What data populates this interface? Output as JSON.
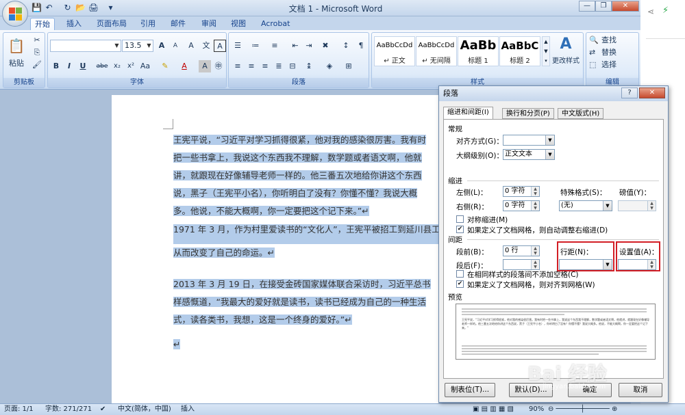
{
  "window": {
    "title": "文档 1 - Microsoft Word"
  },
  "qat": {
    "save": "💾",
    "undo": "↶",
    "redo": "↻",
    "open": "📂",
    "print": "🖨",
    "more": "▾"
  },
  "tabs": [
    "开始",
    "插入",
    "页面布局",
    "引用",
    "邮件",
    "审阅",
    "视图",
    "Acrobat"
  ],
  "ribbon": {
    "clipboard": {
      "label": "剪贴板",
      "paste": "粘贴"
    },
    "font": {
      "label": "字体",
      "name": "",
      "size": "13.5",
      "bold": "B",
      "italic": "I",
      "underline": "U",
      "strike": "abe",
      "sub": "x₂",
      "sup": "x²",
      "case": "Aa",
      "grow": "A",
      "shrink": "A",
      "clear": "A"
    },
    "paragraph": {
      "label": "段落"
    },
    "styles": {
      "label": "样式",
      "items": [
        {
          "sample": "AaBbCcDd",
          "name": "↵ 正文"
        },
        {
          "sample": "AaBbCcDd",
          "name": "↵ 无间隔"
        },
        {
          "sample": "AaBb",
          "name": "标题 1"
        },
        {
          "sample": "AaBbC",
          "name": "标题 2"
        }
      ],
      "change": "更改样式"
    },
    "editing": {
      "label": "编辑",
      "find": "查找",
      "replace": "替换",
      "select": "选择"
    }
  },
  "document": {
    "lines": [
      "王宪平说，“习近平对学习抓得很紧，他对我的感染很厉害。我有时",
      "把一些书拿上，我说这个东西我不理解，数学题或者语文啊，他就",
      "讲，就跟现在好像辅导老师一样的。他三番五次地给你讲这个东西",
      "说，黑子（王宪平小名），你听明白了没有？你懂不懂？我说大概",
      "多。他说，不能大概啊，你一定要把这个记下来。”↵",
      "1971 年 3 月，作为村里爱读书的“文化人”，王宪平被招工到延川县工",
      "从而改变了自己的命运。↵",
      "2013 年 3 月 19 日，在接受金砖国家媒体联合采访时，习近平总书",
      "样感慨道，“我最大的爱好就是读书，读书已经成为自己的一种生活",
      "式，读各类书，我想，这是一个终身的爱好。”↵",
      "↵"
    ]
  },
  "status": {
    "page": "页面: 1/1",
    "words": "字数: 271/271",
    "lang": "中文(简体，中国)",
    "mode": "插入",
    "zoom": "90%"
  },
  "dialog": {
    "title": "段落",
    "help": "?",
    "close": "✕",
    "tabs": [
      "缩进和间距(I)",
      "换行和分页(P)",
      "中文版式(H)"
    ],
    "general": {
      "label": "常规",
      "align_label": "对齐方式(G)：",
      "align_value": "",
      "outline_label": "大纲级别(O)：",
      "outline_value": "正文文本"
    },
    "indent": {
      "label": "缩进",
      "left_label": "左侧(L)：",
      "left_value": "0 字符",
      "right_label": "右侧(R)：",
      "right_value": "0 字符",
      "special_label": "特殊格式(S)：",
      "special_value": "(无)",
      "by_label": "磅值(Y)：",
      "by_value": "",
      "mirror": "对称缩进(M)",
      "auto_right": "如果定义了文档网格，则自动调整右缩进(D)"
    },
    "spacing": {
      "label": "间距",
      "before_label": "段前(B)：",
      "before_value": "0 行",
      "after_label": "段后(F)：",
      "after_value": "",
      "line_label": "行距(N)：",
      "line_value": "",
      "at_label": "设置值(A)：",
      "at_value": "",
      "no_space": "在相同样式的段落间不添加空格(C)",
      "snap_grid": "如果定义了文档网格，则对齐到网格(W)"
    },
    "preview": {
      "label": "预览",
      "sample_text": "王宪平说，“习近平对学习抓得很紧，他对我的感染很厉害。我有时把一些书拿上，我说这个东西我不理解，数学题或者语文啊，他就讲，就跟现在好像辅导老师一样的。他三番五次地给你讲这个东西说，黑子（王宪平小名），你听明白了没有？你懂不懂？我说大概多。他说，不能大概啊，你一定要把这个记下来。”"
    },
    "buttons": {
      "tabs": "制表位(T)...",
      "default": "默认(D)...",
      "ok": "确定",
      "cancel": "取消"
    }
  },
  "watermark": "Bai 经验",
  "watermark_url": "jingyan.baidu.com"
}
